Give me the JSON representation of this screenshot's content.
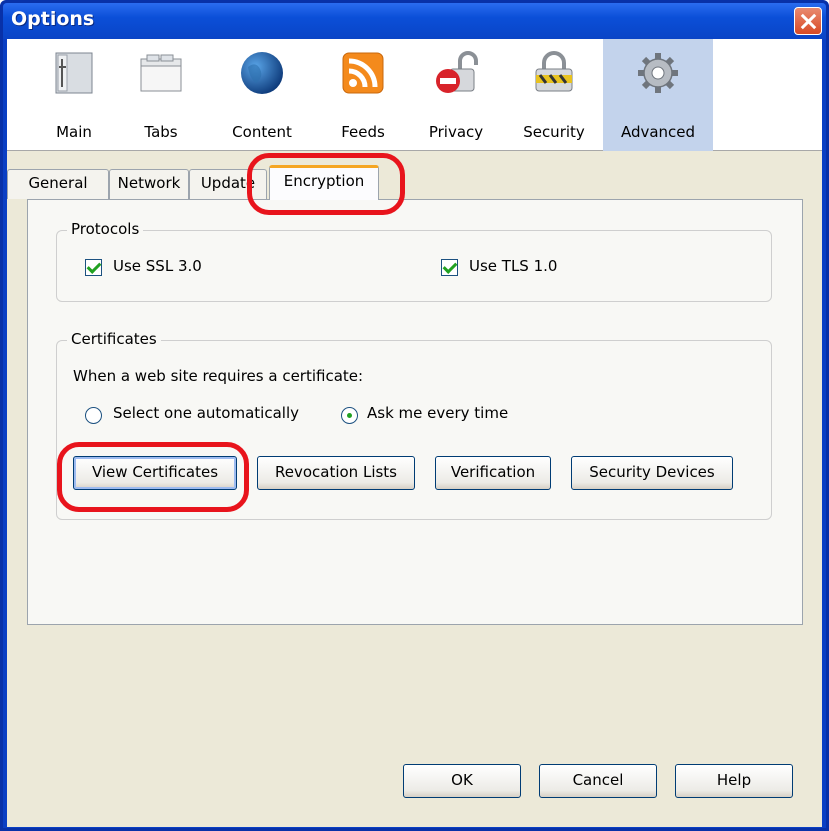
{
  "window": {
    "title": "Options"
  },
  "toolbar": {
    "panes": [
      {
        "label": "Main",
        "icon": "main-pane-icon"
      },
      {
        "label": "Tabs",
        "icon": "tabs-pane-icon"
      },
      {
        "label": "Content",
        "icon": "globe-icon"
      },
      {
        "label": "Feeds",
        "icon": "rss-feed-icon"
      },
      {
        "label": "Privacy",
        "icon": "padlock-stop-icon"
      },
      {
        "label": "Security",
        "icon": "security-padlock-icon"
      },
      {
        "label": "Advanced",
        "icon": "gear-icon"
      }
    ],
    "selected": "Advanced"
  },
  "tabs": [
    "General",
    "Network",
    "Update",
    "Encryption"
  ],
  "active_tab": "Encryption",
  "protocols": {
    "legend": "Protocols",
    "ssl_label": "Use SSL 3.0",
    "ssl_checked": true,
    "tls_label": "Use TLS 1.0",
    "tls_checked": true
  },
  "certificates": {
    "legend": "Certificates",
    "prompt": "When a web site requires a certificate:",
    "option_auto": "Select one automatically",
    "option_ask": "Ask me every time",
    "selected_option": "Ask me every time",
    "buttons": [
      "View Certificates",
      "Revocation Lists",
      "Verification",
      "Security Devices"
    ]
  },
  "footer": {
    "ok": "OK",
    "cancel": "Cancel",
    "help": "Help"
  },
  "colors": {
    "highlight": "#e8141c",
    "titlebar": "#0b4fd8",
    "selected_pane": "#c3d3ec"
  }
}
